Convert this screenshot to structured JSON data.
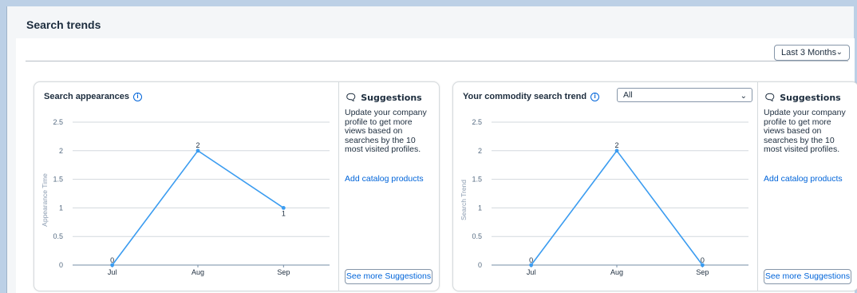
{
  "page": {
    "title": "Search trends",
    "period_select": {
      "value": "Last 3 Months"
    }
  },
  "cards": [
    {
      "title": "Search appearances",
      "suggestions": {
        "heading": "Suggestions",
        "text": "Update your company profile to get more views based on searches by the 10 most visited profiles.",
        "link": "Add catalog products",
        "button": "See more Suggestions"
      }
    },
    {
      "title": "Your commodity search trend",
      "filter": {
        "value": "All"
      },
      "suggestions": {
        "heading": "Suggestions",
        "text": "Update your company profile to get more views based on searches by the 10 most visited profiles.",
        "link": "Add catalog products",
        "button": "See more Suggestions"
      }
    }
  ],
  "chart_data": [
    {
      "type": "line",
      "categories": [
        "Jul",
        "Aug",
        "Sep"
      ],
      "values": [
        0,
        2,
        1
      ],
      "ylabel": "Appearance Time",
      "ylim": [
        0,
        2.5
      ],
      "yticks": [
        "0",
        "0.5",
        "1",
        "1.5",
        "2",
        "2.5"
      ],
      "grid": true,
      "color": "#3b9cf0"
    },
    {
      "type": "line",
      "categories": [
        "Jul",
        "Aug",
        "Sep"
      ],
      "values": [
        0,
        2,
        0
      ],
      "ylabel": "Search Trend",
      "ylim": [
        0,
        2.5
      ],
      "yticks": [
        "0",
        "0.5",
        "1",
        "1.5",
        "2",
        "2.5"
      ],
      "grid": true,
      "color": "#3b9cf0"
    }
  ]
}
